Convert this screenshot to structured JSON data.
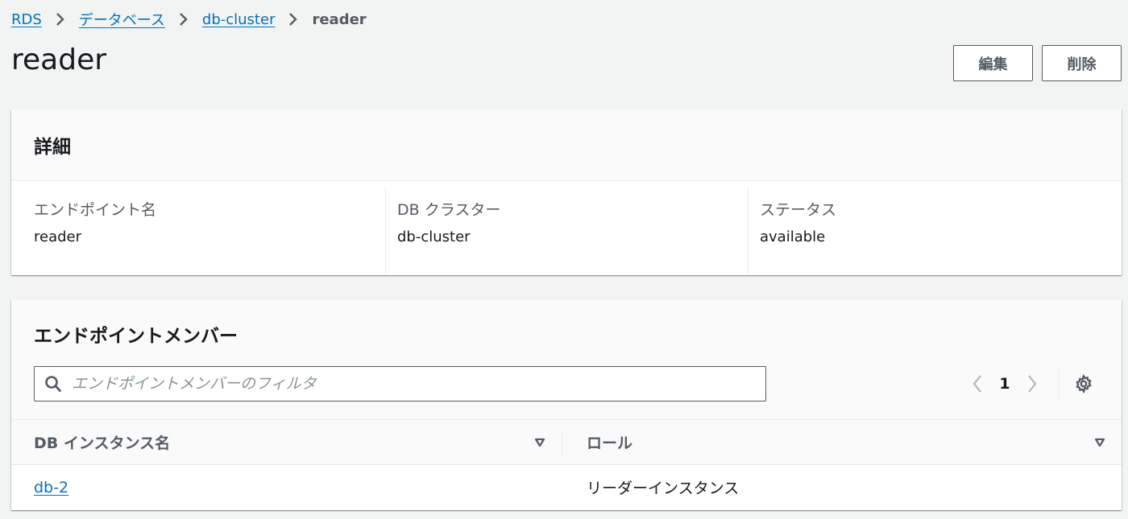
{
  "breadcrumb": {
    "items": [
      "RDS",
      "データベース",
      "db-cluster"
    ],
    "current": "reader"
  },
  "header": {
    "title": "reader",
    "edit_label": "編集",
    "delete_label": "削除"
  },
  "details": {
    "title": "詳細",
    "fields": [
      {
        "label": "エンドポイント名",
        "value": "reader"
      },
      {
        "label": "DB クラスター",
        "value": "db-cluster"
      },
      {
        "label": "ステータス",
        "value": "available"
      }
    ]
  },
  "members": {
    "title": "エンドポイントメンバー",
    "filter_placeholder": "エンドポイントメンバーのフィルタ",
    "page": "1",
    "columns": [
      "DB インスタンス名",
      "ロール"
    ],
    "rows": [
      {
        "name": "db-2",
        "role": "リーダーインスタンス"
      }
    ]
  },
  "icons": {
    "separator": "chevron-right-icon",
    "search": "search-icon",
    "prev": "chevron-left-icon",
    "next": "chevron-right-icon",
    "settings": "gear-icon",
    "sort": "sort-down-icon"
  },
  "colors": {
    "link": "#0073bb",
    "background": "#f2f3f3",
    "text": "#16191f",
    "muted": "#545b64"
  }
}
